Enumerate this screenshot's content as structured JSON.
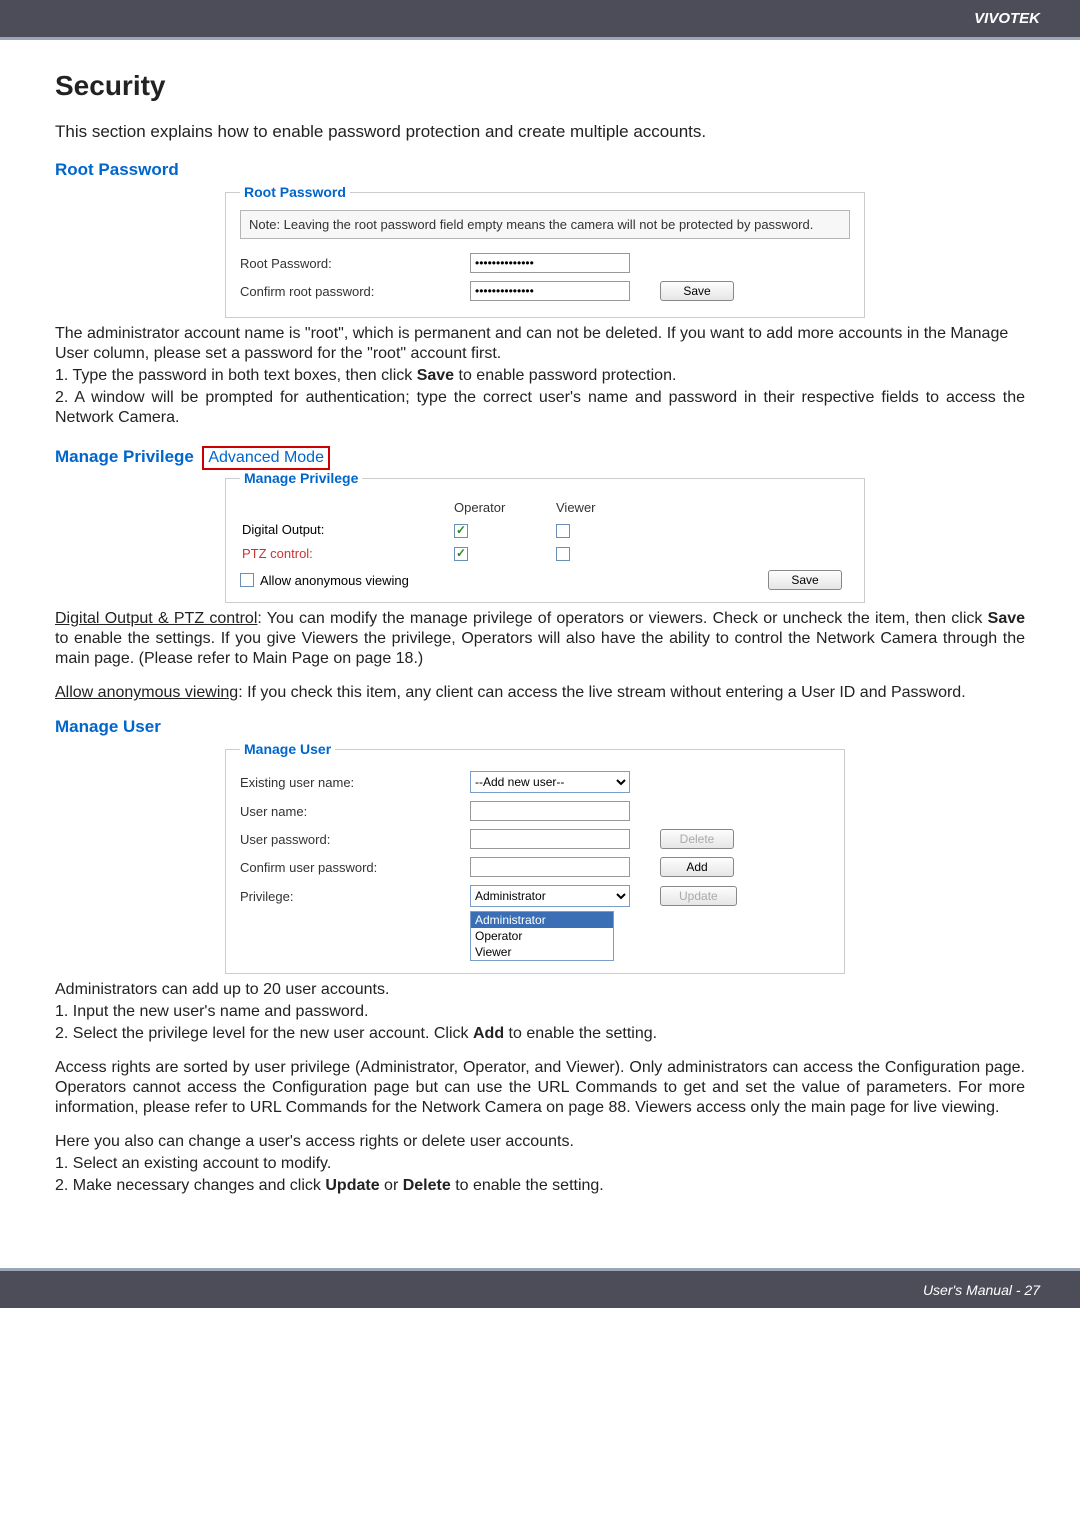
{
  "header": {
    "brand": "VIVOTEK"
  },
  "title": "Security",
  "intro": "This section explains how to enable password protection and create multiple accounts.",
  "root_pw": {
    "section_label": "Root Password",
    "legend": "Root Password",
    "note": "Note: Leaving the root password field empty means the camera will not be protected by password.",
    "rows": {
      "root_label": "Root Password:",
      "confirm_label": "Confirm root password:",
      "root_value": "●●●●●●●●●●●●●●",
      "confirm_value": "●●●●●●●●●●●●●●"
    },
    "save_btn": "Save"
  },
  "root_pw_text": {
    "p1a": "The administrator account name is \"root\", which is permanent and can not be deleted. If you want to add more accounts in the Manage User column, please set a password for the \"root\" account first.",
    "p2": "1. Type the password in both text boxes, then click ",
    "p2b": "Save",
    "p2c": " to enable password protection.",
    "p3": "2. A window will be prompted for authentication; type the correct user's name and password in their respective fields to access the Network Camera."
  },
  "manage_priv": {
    "section_label": "Manage Privilege",
    "adv_mode": "Advanced Mode",
    "legend": "Manage Privilege",
    "headers": {
      "operator": "Operator",
      "viewer": "Viewer"
    },
    "rows": {
      "digital_output": "Digital Output:",
      "ptz_control": "PTZ control:",
      "allow_anon": "Allow anonymous viewing"
    },
    "save_btn": "Save"
  },
  "manage_priv_text": {
    "p1_u": "Digital Output & PTZ control",
    "p1a": ": You can modify the manage privilege of operators or viewers. Check or uncheck the item, then click ",
    "p1b": "Save",
    "p1c": " to enable the settings. If you give Viewers the privilege, Operators will also have the ability to control the Network Camera through the main page. (Please refer to Main Page on page 18.)",
    "p2_u": "Allow anonymous viewing",
    "p2a": ": If you check this item, any client can access the live stream without entering a User ID and Password."
  },
  "manage_user": {
    "section_label": "Manage User",
    "legend": "Manage User",
    "rows": {
      "existing": "Existing user name:",
      "username": "User name:",
      "userpw": "User password:",
      "confirmpw": "Confirm user password:",
      "privilege": "Privilege:"
    },
    "existing_sel": "--Add new user--",
    "priv_sel": "Administrator",
    "priv_options": [
      "Administrator",
      "Operator",
      "Viewer"
    ],
    "buttons": {
      "delete": "Delete",
      "add": "Add",
      "update": "Update"
    }
  },
  "manage_user_text": {
    "l1": "Administrators can add up to 20 user accounts.",
    "l2": "1. Input the new user's name and password.",
    "l3a": "2. Select the privilege level for the new user account. Click ",
    "l3b": "Add",
    "l3c": " to enable the setting.",
    "p2": "Access rights are sorted by user privilege (Administrator, Operator, and Viewer). Only administrators can access the Configuration page. Operators cannot access the Configuration page but can use the URL Commands to get and set the value of parameters. For more information, please refer to URL Commands for the Network Camera on page 88. Viewers access only the main page for live viewing.",
    "l4": "Here you also can change a user's access rights or delete user accounts.",
    "l5": "1. Select an existing account to modify.",
    "l6a": "2. Make necessary changes and click ",
    "l6b": "Update",
    "l6c": " or ",
    "l6d": "Delete",
    "l6e": " to enable the setting."
  },
  "footer": {
    "text": "User's Manual - 27"
  }
}
